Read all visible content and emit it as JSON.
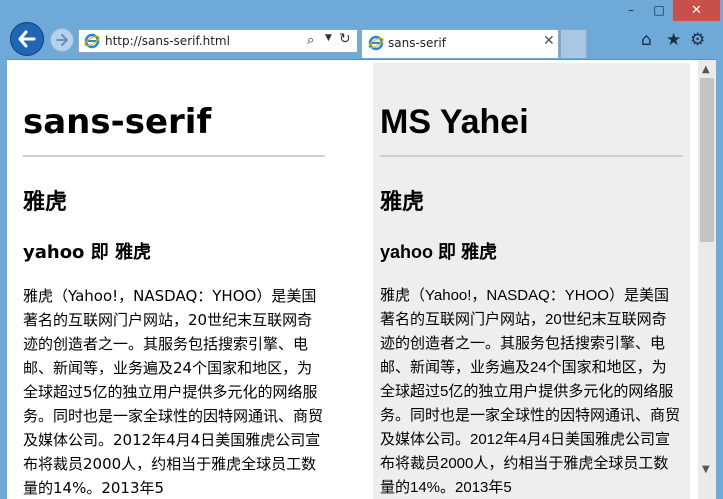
{
  "window": {
    "controls": {
      "minimize": "–",
      "maximize": "□",
      "close": "✕"
    }
  },
  "toolbar": {
    "address_url": "http://sans-serif.html",
    "tab_title": "sans-serif",
    "icons": [
      "back-icon",
      "forward-icon",
      "search-icon",
      "refresh-icon",
      "home-icon",
      "favorites-icon",
      "gear-icon"
    ]
  },
  "content": {
    "left": {
      "heading": "sans-serif",
      "subheading": "雅虎",
      "subsubheading": "yahoo 即 雅虎",
      "paragraph": "雅虎（Yahoo!，NASDAQ：YHOO）是美国著名的互联网门户网站，20世纪末互联网奇迹的创造者之一。其服务包括搜索引擎、电邮、新闻等，业务遍及24个国家和地区，为全球超过5亿的独立用户提供多元化的网络服务。同时也是一家全球性的因特网通讯、商贸及媒体公司。2012年4月4日美国雅虎公司宣布将裁员2000人，约相当于雅虎全球员工数量的14%。2013年5"
    },
    "right": {
      "heading": "MS Yahei",
      "subheading": "雅虎",
      "subsubheading": "yahoo 即 雅虎",
      "paragraph": "雅虎（Yahoo!，NASDAQ：YHOO）是美国著名的互联网门户网站，20世纪末互联网奇迹的创造者之一。其服务包括搜索引擎、电邮、新闻等，业务遍及24个国家和地区，为全球超过5亿的独立用户提供多元化的网络服务。同时也是一家全球性的因特网通讯、商贸及媒体公司。2012年4月4日美国雅虎公司宣布将裁员2000人，约相当于雅虎全球员工数量的14%。2013年5"
    }
  }
}
